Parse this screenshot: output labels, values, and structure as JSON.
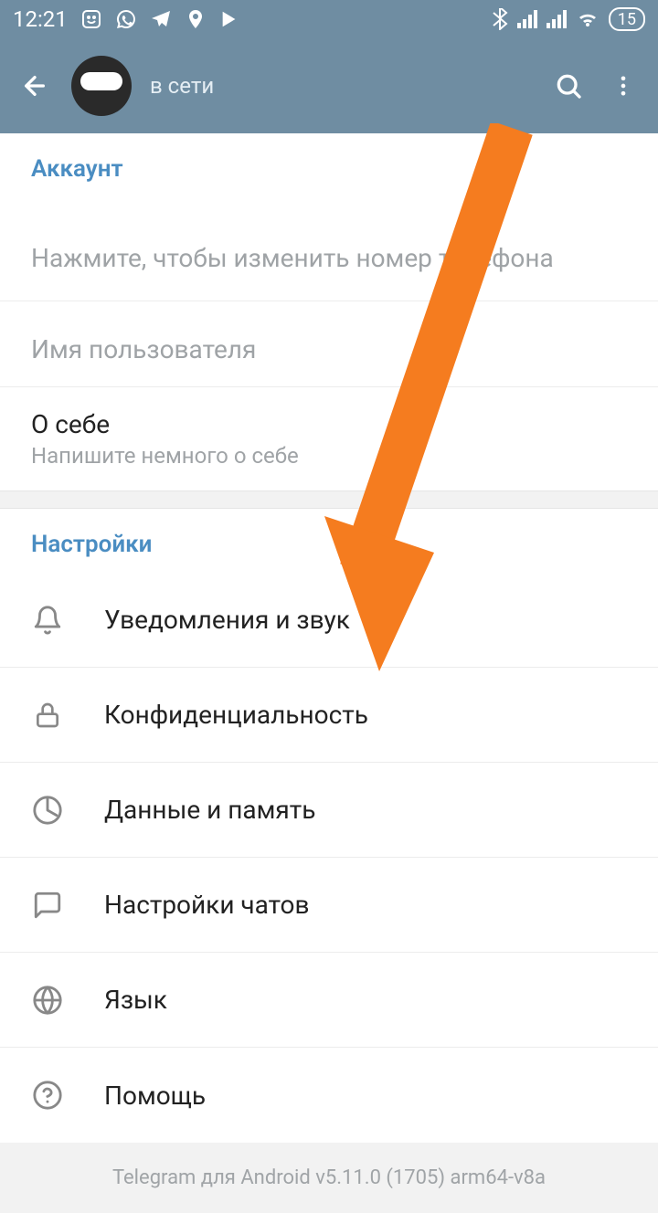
{
  "status_bar": {
    "time": "12:21",
    "battery": "15"
  },
  "header": {
    "user_status": "в сети"
  },
  "account": {
    "header": "Аккаунт",
    "phone_hint": "Нажмите, чтобы изменить номер телефона",
    "username_label": "Имя пользователя",
    "about_title": "О себе",
    "about_hint": "Напишите немного о себе"
  },
  "settings": {
    "header": "Настройки",
    "items": [
      {
        "label": "Уведомления и звук",
        "icon": "bell"
      },
      {
        "label": "Конфиденциальность",
        "icon": "lock"
      },
      {
        "label": "Данные и память",
        "icon": "data"
      },
      {
        "label": "Настройки чатов",
        "icon": "chat"
      },
      {
        "label": "Язык",
        "icon": "globe"
      },
      {
        "label": "Помощь",
        "icon": "help"
      }
    ]
  },
  "footer": {
    "version": "Telegram для Android v5.11.0 (1705) arm64-v8a"
  }
}
